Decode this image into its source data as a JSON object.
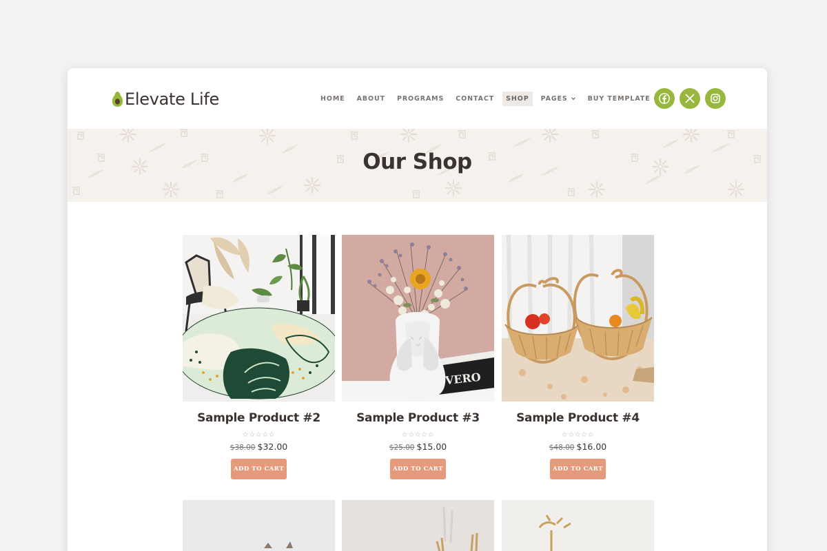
{
  "site": {
    "name": "Elevate Life"
  },
  "nav": {
    "items": [
      {
        "label": "HOME",
        "active": false,
        "dropdown": false
      },
      {
        "label": "ABOUT",
        "active": false,
        "dropdown": false
      },
      {
        "label": "PROGRAMS",
        "active": false,
        "dropdown": false
      },
      {
        "label": "CONTACT",
        "active": false,
        "dropdown": false
      },
      {
        "label": "SHOP",
        "active": true,
        "dropdown": false
      },
      {
        "label": "PAGES",
        "active": false,
        "dropdown": true
      },
      {
        "label": "BUY TEMPLATE",
        "active": false,
        "dropdown": true
      }
    ]
  },
  "socials": [
    {
      "icon": "facebook-icon"
    },
    {
      "icon": "x-icon"
    },
    {
      "icon": "instagram-icon"
    }
  ],
  "banner": {
    "title": "Our Shop"
  },
  "products": [
    {
      "title": "Sample Product #2",
      "old_price": "$38.00",
      "price": "$32.00",
      "button": "ADD TO CART",
      "rating_stars": "☆☆☆☆☆",
      "image": "round-rug-photo"
    },
    {
      "title": "Sample Product #3",
      "old_price": "$25.00",
      "price": "$15.00",
      "button": "ADD TO CART",
      "rating_stars": "☆☆☆☆☆",
      "image": "face-vase-flowers-photo"
    },
    {
      "title": "Sample Product #4",
      "old_price": "$48.00",
      "price": "$16.00",
      "button": "ADD TO CART",
      "rating_stars": "☆☆☆☆☆",
      "image": "wooden-apple-baskets-photo"
    }
  ],
  "colors": {
    "accent_green": "#97b83d",
    "button_peach": "#e59b7b",
    "banner_bg": "#f5f1ec",
    "text_dark": "#3b332f"
  }
}
